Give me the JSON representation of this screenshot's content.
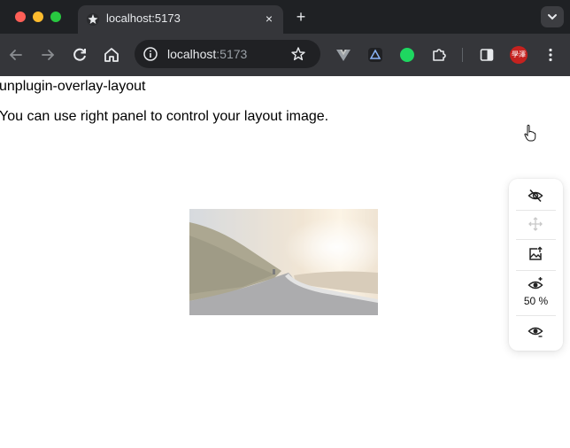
{
  "browser": {
    "tab_title": "localhost:5173",
    "tab_close": "×",
    "new_tab": "+",
    "url_host": "localhost",
    "url_port": ":5173",
    "profile_initials": "學澤"
  },
  "page": {
    "heading": "unplugin-overlay-layout",
    "description": "You can use right panel to control your layout image."
  },
  "panel": {
    "opacity_value": "50 %"
  },
  "colors": {
    "chrome_dark": "#1f2124",
    "toolbar": "#35363a",
    "accent_green": "#1ed760",
    "profile_red": "#c5221f"
  }
}
